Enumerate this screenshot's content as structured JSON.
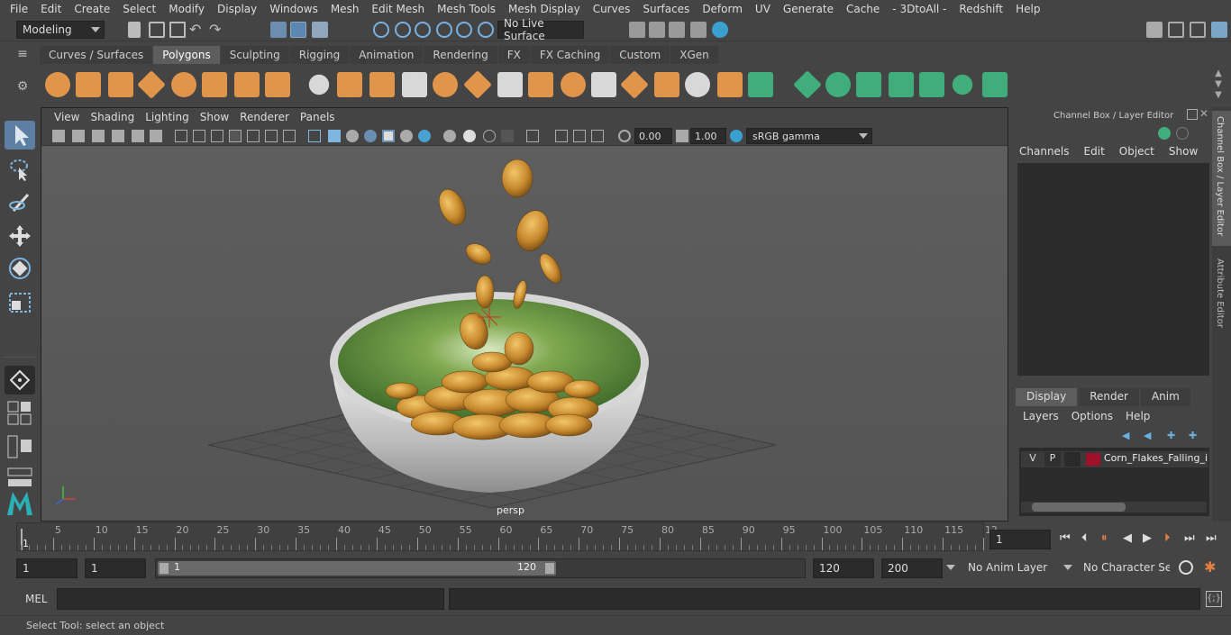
{
  "menus": [
    "File",
    "Edit",
    "Create",
    "Select",
    "Modify",
    "Display",
    "Windows",
    "Mesh",
    "Edit Mesh",
    "Mesh Tools",
    "Mesh Display",
    "Curves",
    "Surfaces",
    "Deform",
    "UV",
    "Generate",
    "Cache",
    "- 3DtoAll -",
    "Redshift",
    "Help"
  ],
  "statusline": {
    "mode": "Modeling",
    "live_surface": "No Live Surface"
  },
  "shelf_tabs": [
    {
      "label": "Curves / Surfaces",
      "active": false
    },
    {
      "label": "Polygons",
      "active": true
    },
    {
      "label": "Sculpting",
      "active": false
    },
    {
      "label": "Rigging",
      "active": false
    },
    {
      "label": "Animation",
      "active": false
    },
    {
      "label": "Rendering",
      "active": false
    },
    {
      "label": "FX",
      "active": false
    },
    {
      "label": "FX Caching",
      "active": false
    },
    {
      "label": "Custom",
      "active": false
    },
    {
      "label": "XGen",
      "active": false
    }
  ],
  "viewport": {
    "menus": [
      "View",
      "Shading",
      "Lighting",
      "Show",
      "Renderer",
      "Panels"
    ],
    "exposure": "0.00",
    "gamma": "1.00",
    "color_space": "sRGB gamma",
    "camera_label": "persp"
  },
  "channel_box": {
    "title": "Channel Box / Layer Editor",
    "menus": [
      "Channels",
      "Edit",
      "Object",
      "Show"
    ],
    "layer_tabs": [
      "Display",
      "Render",
      "Anim"
    ],
    "active_layer_tab": "Display",
    "layer_menus": [
      "Layers",
      "Options",
      "Help"
    ],
    "layers": [
      {
        "visible": "V",
        "playback": "P",
        "color": "#a0102a",
        "name": "Corn_Flakes_Falling_ir"
      }
    ]
  },
  "side_tabs": [
    "Channel Box / Layer Editor",
    "Attribute Editor"
  ],
  "timeline": {
    "ticks": [
      "5",
      "10",
      "15",
      "20",
      "25",
      "30",
      "35",
      "40",
      "45",
      "50",
      "55",
      "60",
      "65",
      "70",
      "75",
      "80",
      "85",
      "90",
      "95",
      "100",
      "105",
      "110",
      "115",
      "12"
    ],
    "start_marker": "1",
    "current_frame": "1"
  },
  "range": {
    "start_time": "1",
    "playback_start": "1",
    "slider_start": "1",
    "slider_end": "120",
    "playback_end": "120",
    "end_time": "200",
    "anim_layer": "No Anim Layer",
    "character_set": "No Character Set"
  },
  "command": {
    "label": "MEL"
  },
  "help_line": "Select Tool: select an object",
  "colors": {
    "accent_orange": "#e0954a",
    "accent_green": "#3fae7a",
    "bowl_inner": "#5f8a3a",
    "flake": "#c98a2e"
  }
}
